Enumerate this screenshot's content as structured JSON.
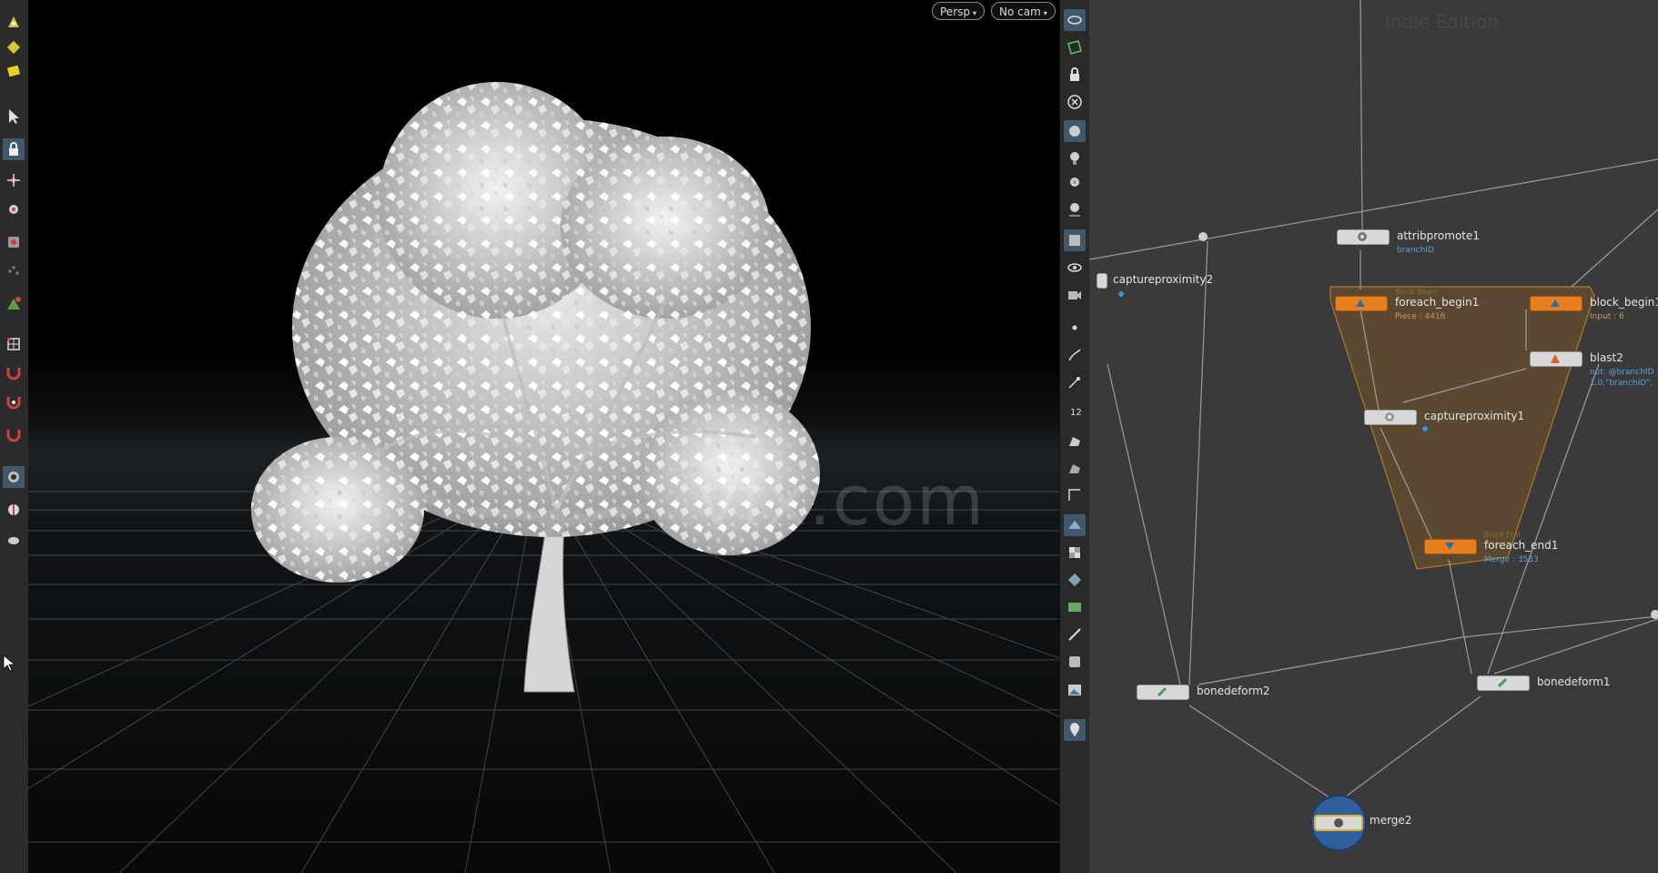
{
  "viewport": {
    "view_label": "Persp",
    "camera_label": "No cam",
    "watermark": "vfx.com"
  },
  "network": {
    "edition_label": "Indie Edition",
    "nodes": [
      {
        "name": "attribpromote1",
        "info": "branchID"
      },
      {
        "name": "captureproximity2"
      },
      {
        "name": "foreach_begin1",
        "info": "Piece : 4416",
        "tag": "Block Begin"
      },
      {
        "name": "block_begin1",
        "info": "Input : 6"
      },
      {
        "name": "blast2",
        "info": "not: @branchID",
        "info2": "1,0,\"branchID\","
      },
      {
        "name": "captureproximity1"
      },
      {
        "name": "foreach_end1",
        "info": "Merge : 3533",
        "tag": "Block End"
      },
      {
        "name": "bonedeform2"
      },
      {
        "name": "bonedeform1"
      },
      {
        "name": "merge2"
      }
    ]
  },
  "colors": {
    "node_orange": "#e87f1e",
    "node_gray": "#d8d8d8",
    "network_bg": "#3a3a3a",
    "info_blue": "#5ba0d8",
    "active_tool": "#41586c"
  }
}
